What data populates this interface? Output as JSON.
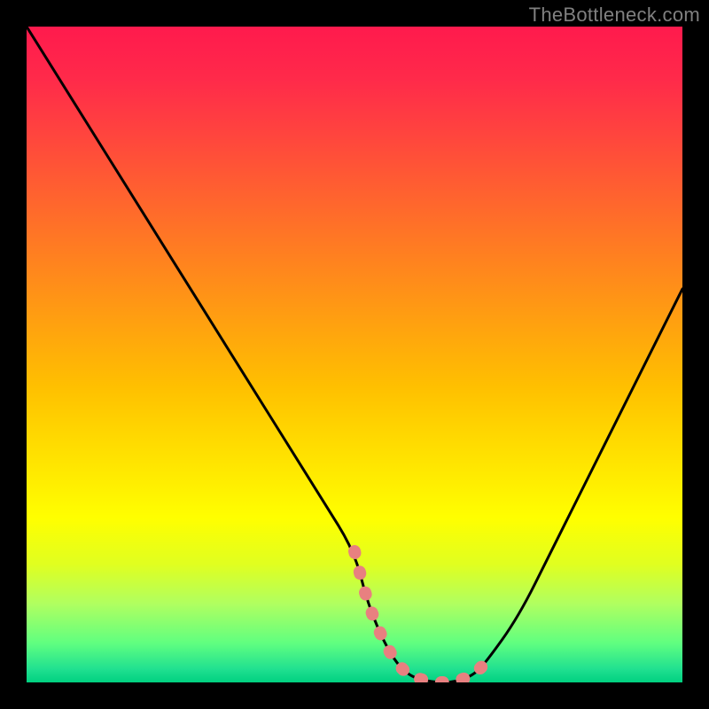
{
  "watermark": "TheBottleneck.com",
  "chart_data": {
    "type": "line",
    "title": "",
    "xlabel": "",
    "ylabel": "",
    "xlim": [
      0,
      100
    ],
    "ylim": [
      0,
      100
    ],
    "background_gradient": {
      "direction": "vertical",
      "stops": [
        {
          "pos": 0,
          "color": "#ff1a4d"
        },
        {
          "pos": 50,
          "color": "#ffc000"
        },
        {
          "pos": 75,
          "color": "#ffff00"
        },
        {
          "pos": 100,
          "color": "#00d080"
        }
      ]
    },
    "series": [
      {
        "name": "bottleneck-curve",
        "color": "#000000",
        "x": [
          0,
          5,
          10,
          15,
          20,
          25,
          30,
          35,
          40,
          45,
          50,
          52,
          55,
          58,
          62,
          65,
          68,
          70,
          75,
          80,
          85,
          90,
          95,
          100
        ],
        "values": [
          100,
          92,
          84,
          76,
          68,
          60,
          52,
          44,
          36,
          28,
          20,
          12,
          5,
          1,
          0,
          0,
          1,
          3,
          10,
          20,
          30,
          40,
          50,
          60
        ]
      },
      {
        "name": "highlight-segment",
        "color": "#e88080",
        "thick": true,
        "x": [
          50,
          52,
          55,
          58,
          62,
          65,
          68,
          70
        ],
        "values": [
          20,
          12,
          5,
          1,
          0,
          0,
          1,
          3
        ]
      }
    ]
  }
}
